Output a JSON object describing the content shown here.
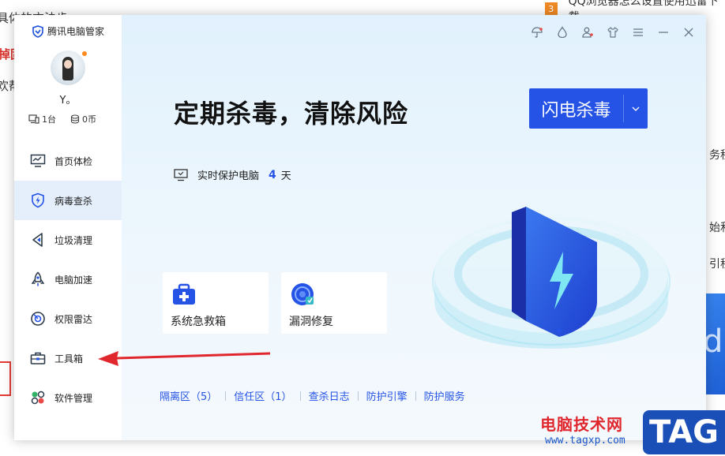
{
  "background": {
    "snippets": [
      "具体的方法步",
      "掉固",
      "欢帮"
    ],
    "right_snippets": [
      "务程",
      "始和",
      "引程"
    ],
    "qq_rank": "3",
    "qq_title": "QQ浏览器怎么设置使用迅雷下载"
  },
  "app": {
    "brand": "腾讯电脑管家",
    "user": {
      "name": "Y。",
      "devices": "1台",
      "coins": "0币"
    },
    "nav": [
      {
        "label": "首页体检",
        "icon": "monitor-icon"
      },
      {
        "label": "病毒查杀",
        "icon": "shield-lightning-icon"
      },
      {
        "label": "垃圾清理",
        "icon": "broom-icon"
      },
      {
        "label": "电脑加速",
        "icon": "rocket-icon"
      },
      {
        "label": "权限雷达",
        "icon": "radar-icon"
      },
      {
        "label": "工具箱",
        "icon": "toolbox-icon"
      },
      {
        "label": "软件管理",
        "icon": "apps-icon"
      }
    ],
    "active_nav": "病毒查杀",
    "titlebar": [
      "umbrella-icon",
      "drop-icon",
      "person-icon",
      "tshirt-icon",
      "menu-icon",
      "minimize-icon",
      "close-icon"
    ]
  },
  "main": {
    "headline": "定期杀毒，清除风险",
    "scan_button": "闪电杀毒",
    "protect_label": "实时保护电脑",
    "protect_days": "4",
    "protect_unit": "天",
    "cards": [
      {
        "label": "系统急救箱",
        "icon": "first-aid-icon"
      },
      {
        "label": "漏洞修复",
        "icon": "patch-icon"
      }
    ],
    "links": [
      "隔离区（5）",
      "信任区（1）",
      "查杀日志",
      "防护引擎",
      "防护服务"
    ]
  },
  "colors": {
    "accent": "#2553e6",
    "arrow": "#e0272d"
  },
  "watermark": {
    "site_name": "电脑技术网",
    "url": "www.tagxp.com",
    "tag": "TAG"
  }
}
